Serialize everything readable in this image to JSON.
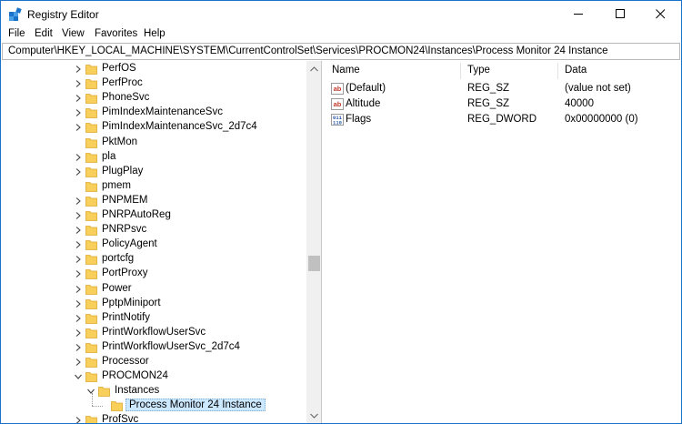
{
  "window": {
    "title": "Registry Editor"
  },
  "menu": [
    "File",
    "Edit",
    "View",
    "Favorites",
    "Help"
  ],
  "address": "Computer\\HKEY_LOCAL_MACHINE\\SYSTEM\\CurrentControlSet\\Services\\PROCMON24\\Instances\\Process Monitor 24 Instance",
  "tree": [
    {
      "label": "PerfOS",
      "depth": 0,
      "expander": "collapsed"
    },
    {
      "label": "PerfProc",
      "depth": 0,
      "expander": "collapsed"
    },
    {
      "label": "PhoneSvc",
      "depth": 0,
      "expander": "collapsed"
    },
    {
      "label": "PimIndexMaintenanceSvc",
      "depth": 0,
      "expander": "collapsed"
    },
    {
      "label": "PimIndexMaintenanceSvc_2d7c4",
      "depth": 0,
      "expander": "collapsed"
    },
    {
      "label": "PktMon",
      "depth": 0,
      "expander": "none"
    },
    {
      "label": "pla",
      "depth": 0,
      "expander": "collapsed"
    },
    {
      "label": "PlugPlay",
      "depth": 0,
      "expander": "collapsed"
    },
    {
      "label": "pmem",
      "depth": 0,
      "expander": "none"
    },
    {
      "label": "PNPMEM",
      "depth": 0,
      "expander": "collapsed"
    },
    {
      "label": "PNRPAutoReg",
      "depth": 0,
      "expander": "collapsed"
    },
    {
      "label": "PNRPsvc",
      "depth": 0,
      "expander": "collapsed"
    },
    {
      "label": "PolicyAgent",
      "depth": 0,
      "expander": "collapsed"
    },
    {
      "label": "portcfg",
      "depth": 0,
      "expander": "collapsed"
    },
    {
      "label": "PortProxy",
      "depth": 0,
      "expander": "collapsed"
    },
    {
      "label": "Power",
      "depth": 0,
      "expander": "collapsed"
    },
    {
      "label": "PptpMiniport",
      "depth": 0,
      "expander": "collapsed"
    },
    {
      "label": "PrintNotify",
      "depth": 0,
      "expander": "collapsed"
    },
    {
      "label": "PrintWorkflowUserSvc",
      "depth": 0,
      "expander": "collapsed"
    },
    {
      "label": "PrintWorkflowUserSvc_2d7c4",
      "depth": 0,
      "expander": "collapsed"
    },
    {
      "label": "Processor",
      "depth": 0,
      "expander": "collapsed"
    },
    {
      "label": "PROCMON24",
      "depth": 0,
      "expander": "expanded"
    },
    {
      "label": "Instances",
      "depth": 1,
      "expander": "expanded"
    },
    {
      "label": "Process Monitor 24 Instance",
      "depth": 2,
      "expander": "none",
      "selected": true
    },
    {
      "label": "ProfSvc",
      "depth": 0,
      "expander": "collapsed"
    }
  ],
  "values_table": {
    "columns": [
      "Name",
      "Type",
      "Data"
    ],
    "rows": [
      {
        "name": "(Default)",
        "type": "REG_SZ",
        "data": "(value not set)",
        "icon": "string-value-icon"
      },
      {
        "name": "Altitude",
        "type": "REG_SZ",
        "data": "40000",
        "icon": "string-value-icon"
      },
      {
        "name": "Flags",
        "type": "REG_DWORD",
        "data": "0x00000000 (0)",
        "icon": "binary-value-icon"
      }
    ]
  },
  "colors": {
    "accent": "#1a73c8",
    "folder": "#f7cf5a",
    "folder_dark": "#dca92e",
    "selection": "#cce8ff",
    "string_icon": "#c0392b",
    "binary_icon": "#2b5aa7"
  }
}
